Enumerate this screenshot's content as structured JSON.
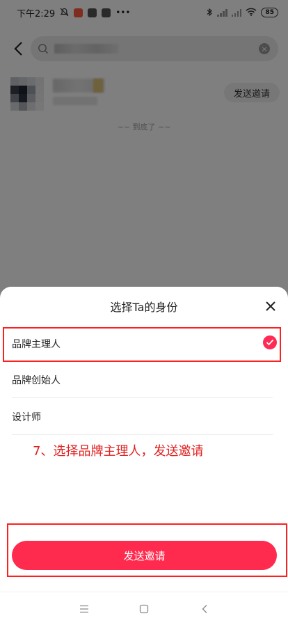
{
  "status_bar": {
    "time": "下午2:29",
    "battery": "85"
  },
  "search": {
    "clear_glyph": "×"
  },
  "result": {
    "invite_label": "发送邀请"
  },
  "list_end_text": "~~ 到底了 ~~",
  "sheet": {
    "title": "选择Ta的身份",
    "options": [
      {
        "label": "品牌主理人",
        "selected": true
      },
      {
        "label": "品牌创始人",
        "selected": false
      },
      {
        "label": "设计师",
        "selected": false
      }
    ],
    "annotation": "7、选择品牌主理人，发送邀请",
    "send_label": "发送邀请"
  },
  "colors": {
    "accent": "#ff2b4e",
    "annotation_red": "#e02020",
    "overlay": "rgba(0,0,0,0.5)"
  },
  "icons": [
    "back-arrow-icon",
    "search-icon",
    "clear-icon",
    "close-icon",
    "check-icon",
    "nav-menu-icon",
    "nav-home-icon",
    "nav-back-icon"
  ]
}
